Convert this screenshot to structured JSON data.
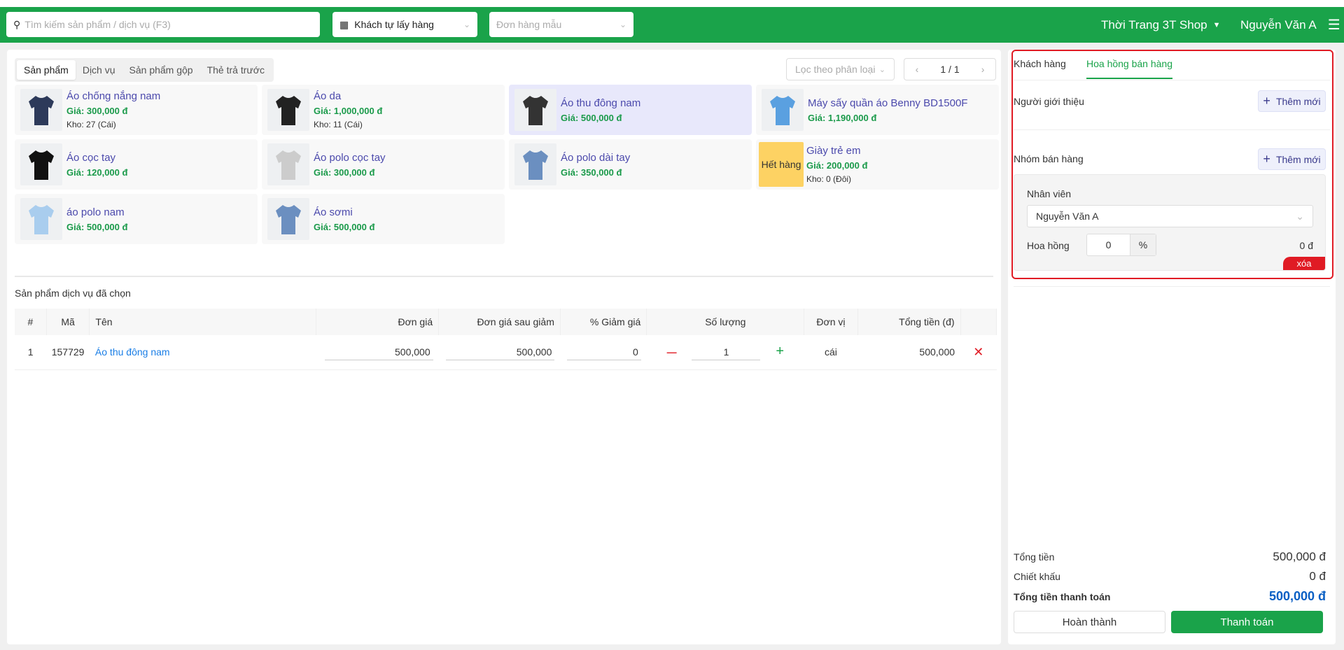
{
  "header": {
    "search_placeholder": "Tìm kiếm sản phẩm / dịch vụ (F3)",
    "delivery": "Khách tự lấy hàng",
    "template_placeholder": "Đơn hàng mẫu",
    "shop": "Thời Trang 3T Shop",
    "user": "Nguyễn Văn A"
  },
  "tabs": [
    "Sản phẩm",
    "Dịch vụ",
    "Sản phẩm gộp",
    "Thẻ trả trước"
  ],
  "filter_placeholder": "Lọc theo phân loại",
  "pager": {
    "current": "1",
    "sep": "/",
    "total": "1"
  },
  "products": [
    {
      "name": "Áo chống nắng nam",
      "price": "Giá: 300,000 đ",
      "stock": "Kho: 27 (Cái)",
      "color": "#2d3a5a"
    },
    {
      "name": "Áo da",
      "price": "Giá: 1,000,000 đ",
      "stock": "Kho: 11 (Cái)",
      "color": "#222"
    },
    {
      "name": "Áo thu đông nam",
      "price": "Giá: 500,000 đ",
      "color": "#333"
    },
    {
      "name": "Máy sấy quần áo Benny BD1500F",
      "price": "Giá: 1,190,000 đ",
      "color": "#5aa0e0"
    },
    {
      "name": "Áo cọc tay",
      "price": "Giá: 120,000 đ",
      "color": "#111"
    },
    {
      "name": "Áo polo cọc tay",
      "price": "Giá: 300,000 đ",
      "color": "#ccc"
    },
    {
      "name": "Áo polo dài tay",
      "price": "Giá: 350,000 đ",
      "color": "#6b8fc0"
    },
    {
      "name": "Giày trẻ em",
      "price": "Giá: 200,000 đ",
      "stock": "Kho: 0 (Đôi)",
      "badge": "Hết hàng"
    },
    {
      "name": "áo polo nam",
      "price": "Giá: 500,000 đ",
      "color": "#a9cdee"
    },
    {
      "name": "Áo sơmi",
      "price": "Giá: 500,000 đ",
      "color": "#6b8fc0"
    }
  ],
  "selected": {
    "title": "Sản phẩm dịch vụ đã chọn",
    "columns": [
      "#",
      "Mã",
      "Tên",
      "Đơn giá",
      "Đơn giá sau giảm",
      "% Giảm giá",
      "Số lượng",
      "Đơn vị",
      "Tổng tiền (đ)"
    ],
    "rows": [
      {
        "idx": "1",
        "code": "157729",
        "name": "Áo thu đông nam",
        "price": "500,000",
        "net": "500,000",
        "disc": "0",
        "qty": "1",
        "unit": "cái",
        "total": "500,000"
      }
    ]
  },
  "right": {
    "tabs": [
      "Khách hàng",
      "Hoa hồng bán hàng"
    ],
    "referrer": "Người giới thiệu",
    "add": "Thêm mới",
    "group": "Nhóm bán hàng",
    "staff_label": "Nhân viên",
    "staff": "Nguyễn Văn A",
    "commission_label": "Hoa hồng",
    "commission": "0",
    "pct": "%",
    "commission_amount": "0 đ",
    "delete": "xóa"
  },
  "summary": {
    "total_label": "Tổng tiền",
    "total": "500,000 đ",
    "discount_label": "Chiết khấu",
    "discount": "0 đ",
    "pay_label": "Tổng tiền thanh toán",
    "pay": "500,000 đ",
    "complete": "Hoàn thành",
    "checkout": "Thanh toán"
  }
}
